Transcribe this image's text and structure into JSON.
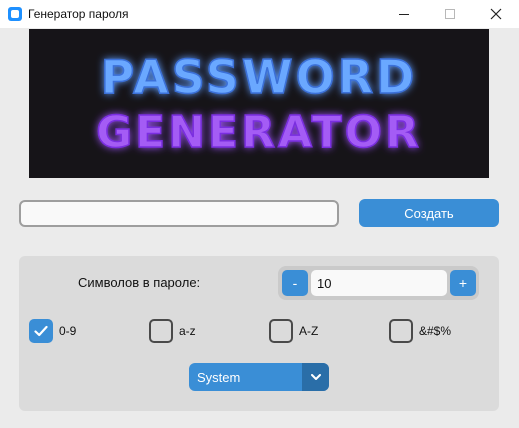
{
  "window": {
    "title": "Генератор пароля"
  },
  "banner": {
    "line1": "PASSWORD",
    "line2": "GENERATOR"
  },
  "password": {
    "value": ""
  },
  "create_button": {
    "label": "Создать"
  },
  "length": {
    "label": "Символов в пароле:",
    "value": "10",
    "minus": "-",
    "plus": "+"
  },
  "charsets": [
    {
      "label": "0-9",
      "checked": true
    },
    {
      "label": "a-z",
      "checked": false
    },
    {
      "label": "A-Z",
      "checked": false
    },
    {
      "label": "&#$%",
      "checked": false
    }
  ],
  "theme_select": {
    "selected": "System"
  },
  "colors": {
    "accent": "#3a8ed6",
    "accent_dark": "#2a6ea8",
    "banner_blue": "#5b9cf5",
    "banner_purple": "#9b4df0"
  }
}
